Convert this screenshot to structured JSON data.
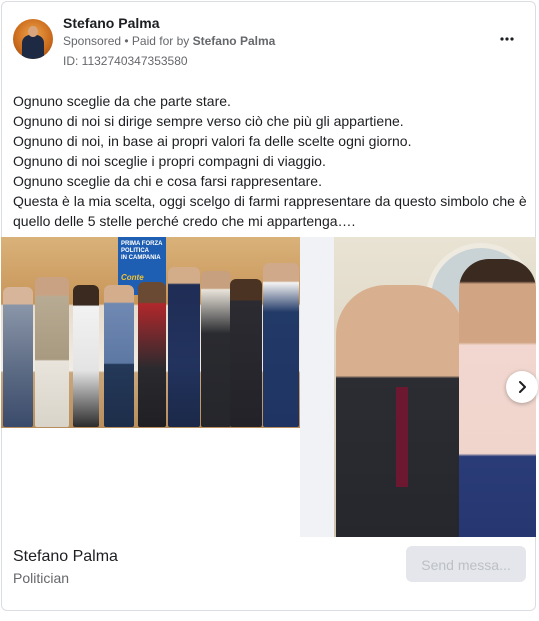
{
  "advertiser": {
    "name": "Stefano Palma",
    "sponsored_label": "Sponsored",
    "separator": " • ",
    "paid_for_prefix": "Paid for by ",
    "paid_for_name": "Stefano Palma",
    "ad_id": "ID: 1132740347353580"
  },
  "more_icon": "more-options-icon",
  "body_lines": [
    "Ognuno sceglie da che parte stare.",
    "Ognuno di noi si dirige sempre verso ciò che più gli appartiene.",
    "Ognuno di noi, in base ai propri valori fa delle scelte ogni giorno.",
    "Ognuno di noi sceglie i propri compagni di viaggio.",
    "Ognuno sceglie da chi e cosa farsi rappresentare.",
    "Questa è la mia scelta, oggi scelgo di farmi rappresentare da questo simbolo che è",
    "quello delle 5 stelle perché credo che mi appartenga…."
  ],
  "photo1_banner": {
    "line1": "PRIMA FORZA",
    "line2": "POLITICA",
    "line3": "IN CAMPANIA",
    "line4": "Conte"
  },
  "footer": {
    "page_name": "Stefano Palma",
    "page_category": "Politician",
    "cta_label": "Send messa..."
  },
  "colors": {
    "secondary_text": "#65676b",
    "button_bg": "#e4e6eb",
    "button_text": "#bcc0c4"
  }
}
